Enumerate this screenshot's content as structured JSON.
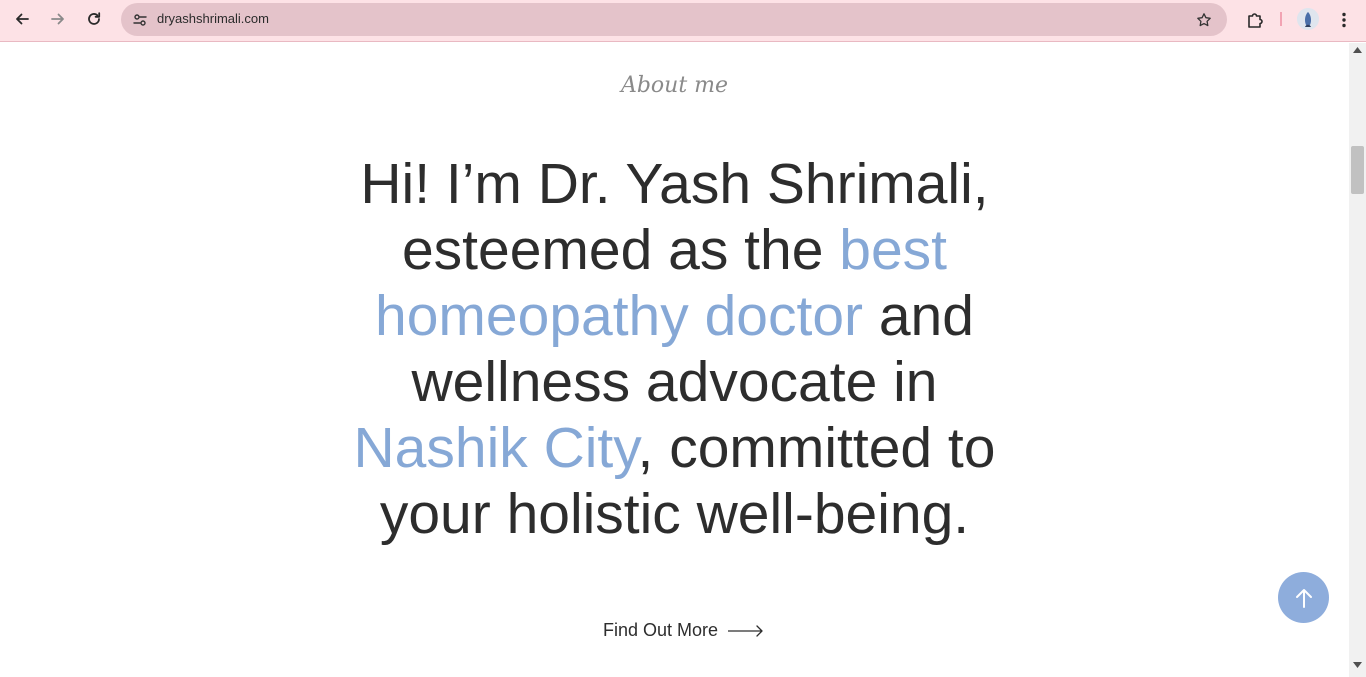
{
  "browser": {
    "url": "dryashshrimali.com",
    "icons": {
      "back": "arrow-left-icon",
      "forward": "arrow-right-icon",
      "reload": "reload-icon",
      "site_info": "tune-icon",
      "bookmark": "star-icon",
      "extensions": "puzzle-icon",
      "profile": "avatar",
      "menu": "kebab-menu-icon"
    }
  },
  "about": {
    "label": "About me",
    "headline": {
      "part1": "Hi! I’m Dr. Yash Shrimali, esteemed as the ",
      "highlight1": "best homeopathy doctor",
      "part2": " and wellness advocate in ",
      "highlight2": "Nashik City",
      "part3": ", committed to your holistic well-being."
    },
    "cta_label": "Find Out More"
  },
  "colors": {
    "accent": "#86a8d6",
    "text": "#2d2d2d",
    "chrome": "#fde2e6",
    "omnibox": "#e4c3ca",
    "scroll_top_button": "#8eaddc"
  }
}
